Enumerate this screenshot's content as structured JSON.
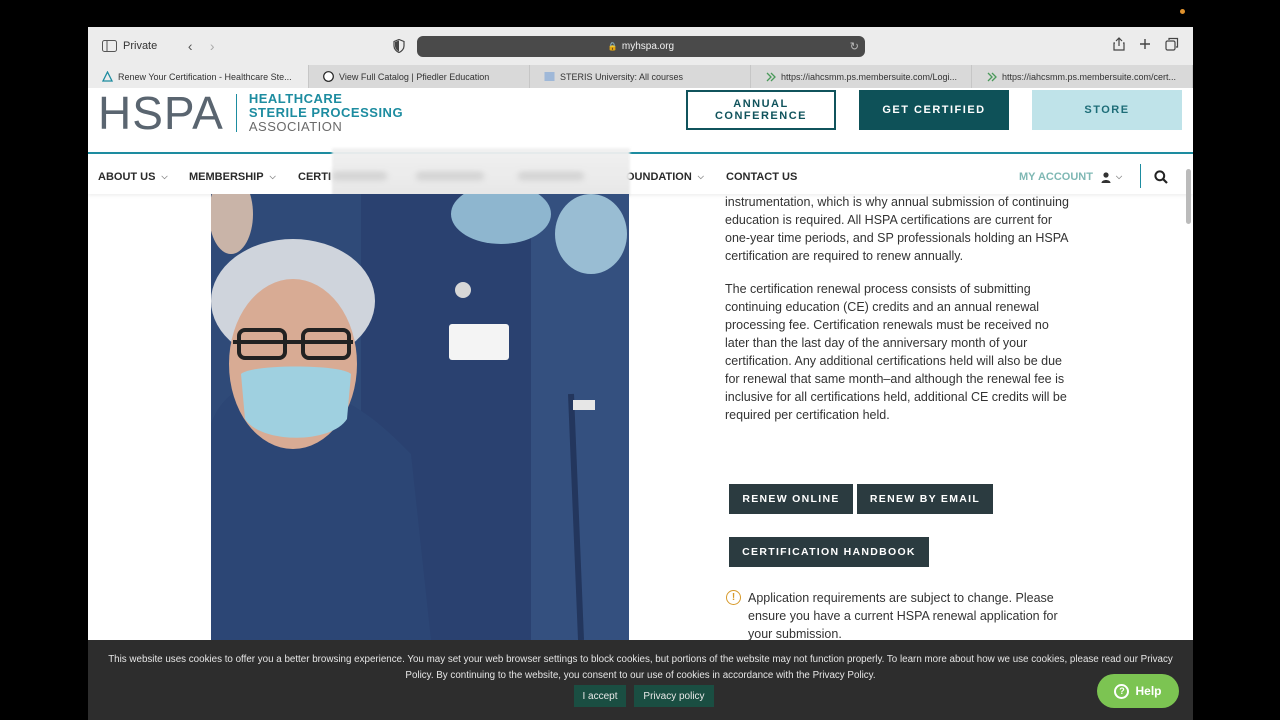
{
  "browser": {
    "private_label": "Private",
    "url": "myhspa.org",
    "tabs": [
      {
        "label": "Renew Your Certification - Healthcare Ste..."
      },
      {
        "label": "View Full Catalog | Pfiedler Education"
      },
      {
        "label": "STERIS University: All courses"
      },
      {
        "label": "https://iahcsmm.ps.membersuite.com/Logi..."
      },
      {
        "label": "https://iahcsmm.ps.membersuite.com/cert..."
      }
    ]
  },
  "header": {
    "logo_letters": "HSPA",
    "logo_line1": "HEALTHCARE",
    "logo_line2": "STERILE PROCESSING",
    "logo_line3": "ASSOCIATION",
    "btn_conference_1": "ANNUAL",
    "btn_conference_2": "CONFERENCE",
    "btn_certified": "GET CERTIFIED",
    "btn_store": "STORE"
  },
  "nav": {
    "about": "ABOUT US",
    "membership": "MEMBERSHIP",
    "certification_partial": "CERTI",
    "foundation_partial": "OUNDATION",
    "contact": "CONTACT US",
    "my_account": "MY ACCOUNT"
  },
  "content": {
    "para1": "instrumentation, which is why annual submission of continuing education is required. All HSPA certifications are current for one-year time periods, and SP professionals holding an HSPA certification are required to renew annually.",
    "para2": "The certification renewal process consists of submitting continuing education (CE) credits and an annual renewal processing fee. Certification renewals must be received no later than the last day of the anniversary month of your certification. Any additional certifications held will also be due for renewal that same month–and although the renewal fee is inclusive for all certifications held, additional CE credits will be required per certification held.",
    "btn_renew_online": "RENEW ONLINE",
    "btn_renew_email": "RENEW BY EMAIL",
    "btn_handbook": "CERTIFICATION HANDBOOK",
    "warning": "Application requirements are subject to change. Please ensure you have a current HSPA renewal application for your submission."
  },
  "cookie": {
    "text": "This website uses cookies to offer you a better browsing experience. You may set your web browser settings to block cookies, but portions of the website may not function properly. To learn more about how we use cookies, please read our Privacy Policy. By continuing to the website, you consent to our use of cookies in accordance with the Privacy Policy.",
    "accept": "I accept",
    "policy": "Privacy policy"
  },
  "help": {
    "label": "Help"
  },
  "colors": {
    "brand_teal": "#1d8ca0",
    "dark_teal": "#0e5158",
    "light_teal": "#bfe3e9",
    "help_green": "#7cc452"
  }
}
